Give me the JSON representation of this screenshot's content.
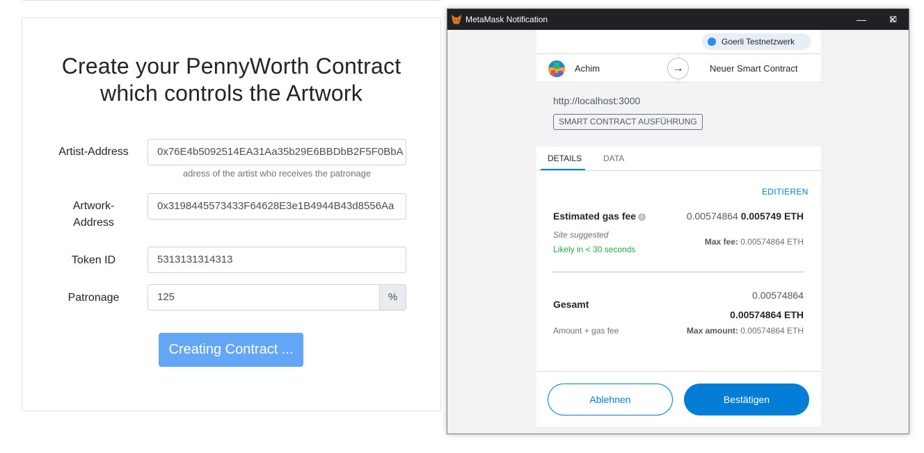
{
  "dapp": {
    "title_line1": "Create your PennyWorth Contract",
    "title_line2": "which controls the Artwork",
    "fields": {
      "artist_label": "Artist-Address",
      "artist_value": "0x76E4b5092514EA31Aa35b29E6BBDbB2F5F0BbA",
      "artist_hint": "adress of the artist who receives the patronage",
      "artwork_label_line1": "Artwork-",
      "artwork_label_line2": "Address",
      "artwork_value": "0x3198445573433F64628E3e1B4944B43d8556Aa",
      "token_label": "Token ID",
      "token_value": "5313131314313",
      "patronage_label": "Patronage",
      "patronage_value": "125",
      "patronage_unit": "%"
    },
    "create_button": "Creating Contract ..."
  },
  "metamask": {
    "window_title": "MetaMask Notification",
    "window_controls": {
      "minimize": "—",
      "maximize": "☐",
      "close": "✕"
    },
    "network": "Goerli Testnetzwerk",
    "account_name": "Achim",
    "arrow": "→",
    "target": "Neuer Smart Contract",
    "origin": "http://localhost:3000",
    "tx_type": "SMART CONTRACT AUSFÜHRUNG",
    "tabs": [
      "DETAILS",
      "DATA"
    ],
    "edit": "EDITIEREN",
    "gas_label": "Estimated gas fee",
    "info_glyph": "i",
    "gas_fiat": "0.00574864",
    "gas_eth": "0.005749 ETH",
    "site_suggested": "Site suggested",
    "likely": "Likely in < 30 seconds",
    "max_fee_label": "Max fee:",
    "max_fee_value": "0.00574864 ETH",
    "total_label": "Gesamt",
    "total_small": "0.00574864",
    "total_big": "0.00574864 ETH",
    "amount_gas": "Amount + gas fee",
    "max_amount_label": "Max amount:",
    "max_amount_value": "0.00574864 ETH",
    "reject": "Ablehnen",
    "confirm": "Bestätigen"
  },
  "colors": {
    "accent": "#037dd6",
    "create_button_bg": "#63a6f8",
    "success": "#28a745",
    "titlebar": "#202124"
  }
}
